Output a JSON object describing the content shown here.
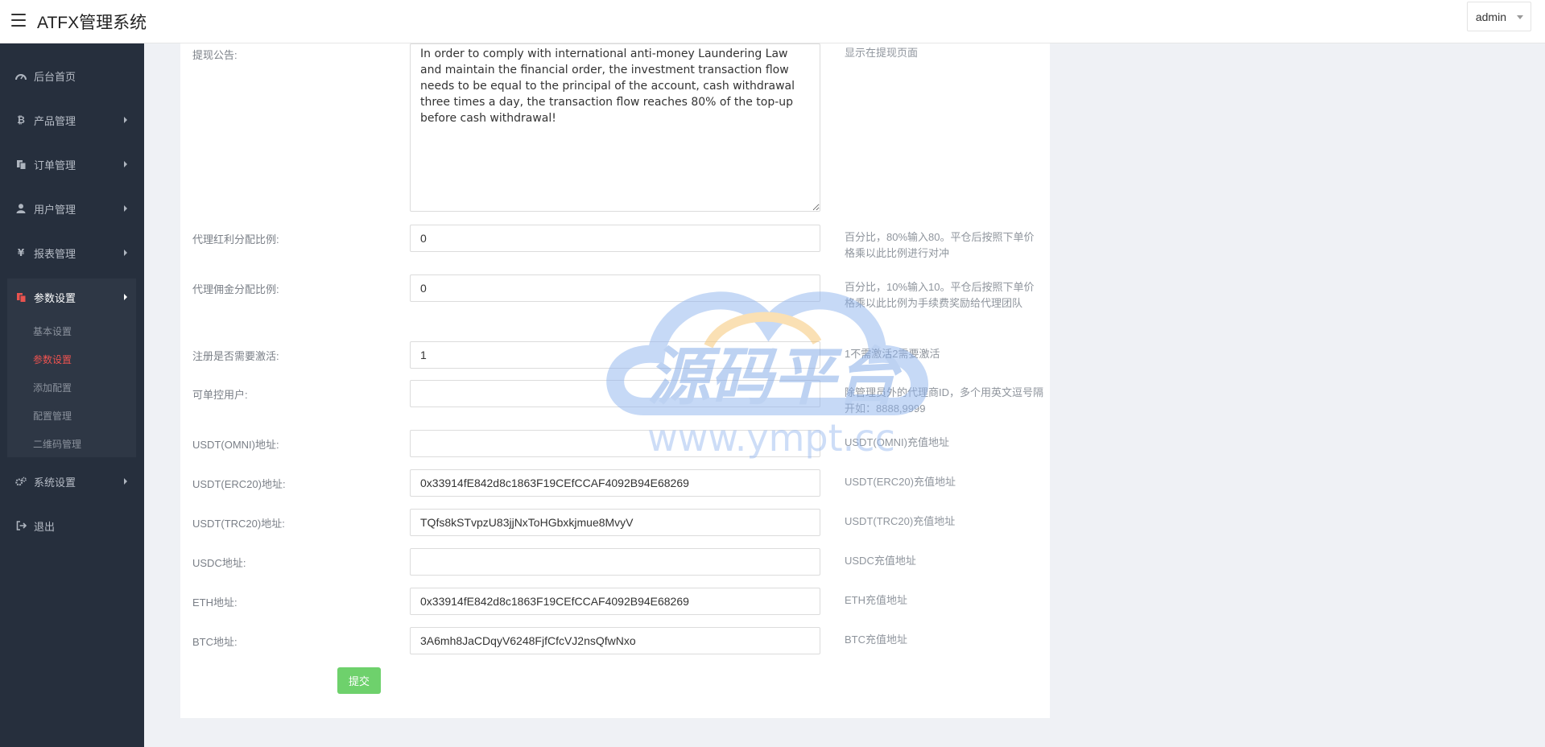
{
  "header": {
    "title": "ATFX管理系统",
    "user_label": "admin"
  },
  "sidebar": {
    "items": [
      {
        "label": "后台首页",
        "icon": "dashboard-icon"
      },
      {
        "label": "产品管理",
        "icon": "bitcoin-icon"
      },
      {
        "label": "订单管理",
        "icon": "copy-icon"
      },
      {
        "label": "用户管理",
        "icon": "user-icon"
      },
      {
        "label": "报表管理",
        "icon": "yen-icon"
      },
      {
        "label": "参数设置",
        "icon": "file-icon"
      },
      {
        "label": "系统设置",
        "icon": "gears-icon"
      },
      {
        "label": "退出",
        "icon": "sign-out-icon"
      }
    ],
    "submenu": [
      {
        "label": "基本设置"
      },
      {
        "label": "参数设置"
      },
      {
        "label": "添加配置"
      },
      {
        "label": "配置管理"
      },
      {
        "label": "二维码管理"
      }
    ]
  },
  "form": {
    "notice": {
      "label": "提现公告:",
      "value": "In order to comply with international anti-money Laundering Law and maintain the financial order, the investment transaction flow needs to be equal to the principal of the account, cash withdrawal three times a day, the transaction flow reaches 80% of the top-up before cash withdrawal!",
      "help": "显示在提现页面"
    },
    "fields": [
      {
        "label": "代理红利分配比例:",
        "value": "0",
        "help": "百分比，80%输入80。平仓后按照下单价格乘以此比例进行对冲"
      },
      {
        "label": "代理佣金分配比例:",
        "value": "0",
        "help": "百分比，10%输入10。平仓后按照下单价格乘以此比例为手续费奖励给代理团队"
      },
      {
        "label": "注册是否需要激活:",
        "value": "1",
        "help": "1不需激活2需要激活"
      },
      {
        "label": "可单控用户:",
        "value": "",
        "help": "除管理员外的代理商ID，多个用英文逗号隔开如：8888,9999"
      },
      {
        "label": "USDT(OMNI)地址:",
        "value": "",
        "help": "USDT(OMNI)充值地址"
      },
      {
        "label": "USDT(ERC20)地址:",
        "value": "0x33914fE842d8c1863F19CEfCCAF4092B94E68269",
        "help": "USDT(ERC20)充值地址"
      },
      {
        "label": "USDT(TRC20)地址:",
        "value": "TQfs8kSTvpzU83jjNxToHGbxkjmue8MvyV",
        "help": "USDT(TRC20)充值地址"
      },
      {
        "label": "USDC地址:",
        "value": "",
        "help": "USDC充值地址"
      },
      {
        "label": "ETH地址:",
        "value": "0x33914fE842d8c1863F19CEfCCAF4092B94E68269",
        "help": "ETH充值地址"
      },
      {
        "label": "BTC地址:",
        "value": "3A6mh8JaCDqyV6248FjfCfcVJ2nsQfwNxo",
        "help": "BTC充值地址"
      }
    ],
    "submit_label": "提交"
  },
  "watermark": {
    "main": "源码平台",
    "url": "www.ympt.cc"
  },
  "colors": {
    "sidebar_bg": "#262f3d",
    "accent_red": "#ef5350",
    "submit_green": "#6ed16c"
  }
}
